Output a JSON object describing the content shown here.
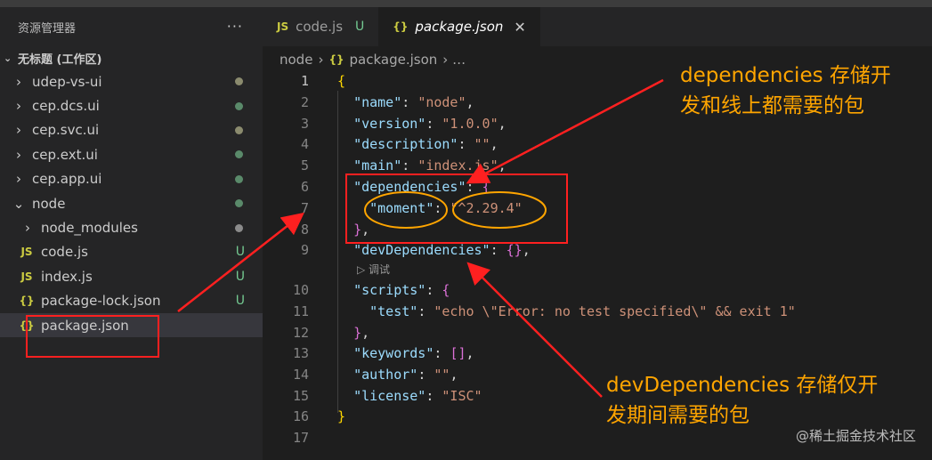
{
  "sidebar": {
    "title": "资源管理器",
    "more": "···",
    "workspace": "无标题 (工作区)",
    "items": [
      {
        "label": "udep-vs-ui",
        "dot": "#8b8b6e"
      },
      {
        "label": "cep.dcs.ui",
        "dot": "#5a8a6a"
      },
      {
        "label": "cep.svc.ui",
        "dot": "#8b8b6e"
      },
      {
        "label": "cep.ext.ui",
        "dot": "#5a8a6a"
      },
      {
        "label": "cep.app.ui",
        "dot": "#5a8a6a"
      },
      {
        "label": "node",
        "dot": "#5a8a6a"
      },
      {
        "label": "node_modules",
        "dot": "#8b8b8b"
      },
      {
        "label": "code.js",
        "badge": "U",
        "icon": "JS"
      },
      {
        "label": "index.js",
        "badge": "U",
        "icon": "JS"
      },
      {
        "label": "package-lock.json",
        "badge": "U",
        "icon": "{}"
      },
      {
        "label": "package.json",
        "icon": "{}"
      }
    ]
  },
  "tabs": [
    {
      "icon": "JS",
      "label": "code.js",
      "status": "U"
    },
    {
      "icon": "{}",
      "label": "package.json",
      "close": "✕"
    }
  ],
  "breadcrumb": {
    "folder": "node",
    "sep": "›",
    "icon": "{}",
    "file": "package.json",
    "more": "› …"
  },
  "editor": {
    "line_numbers": [
      "1",
      "2",
      "3",
      "4",
      "5",
      "6",
      "7",
      "8",
      "9",
      "10",
      "11",
      "12",
      "13",
      "14",
      "15",
      "16",
      "17"
    ],
    "codelens": "▷ 调试",
    "lines": {
      "l2": {
        "key": "\"name\"",
        "val": "\"node\""
      },
      "l3": {
        "key": "\"version\"",
        "val": "\"1.0.0\""
      },
      "l4": {
        "key": "\"description\"",
        "val": "\"\""
      },
      "l5": {
        "key": "\"main\"",
        "val": "\"index.js\""
      },
      "l6": {
        "key": "\"dependencies\""
      },
      "l7": {
        "key": "\"moment\"",
        "val": "\"^2.29.4\""
      },
      "l9": {
        "key": "\"devDependencies\""
      },
      "l10": {
        "key": "\"scripts\""
      },
      "l11": {
        "key": "\"test\"",
        "val": "\"echo \\\"Error: no test specified\\\" && exit 1\""
      },
      "l13": {
        "key": "\"keywords\""
      },
      "l14": {
        "key": "\"author\"",
        "val": "\"\""
      },
      "l15": {
        "key": "\"license\"",
        "val": "\"ISC\""
      }
    }
  },
  "annotations": {
    "dependencies_line1": "dependencies 存储开",
    "dependencies_line2": "发和线上都需要的包",
    "dev_line1": "devDependencies 存储仅开",
    "dev_line2": "发期间需要的包",
    "color": "#ffa500",
    "box_color": "#ff2020",
    "arrow_color": "#ff2020"
  },
  "watermark": "@稀土掘金技术社区"
}
